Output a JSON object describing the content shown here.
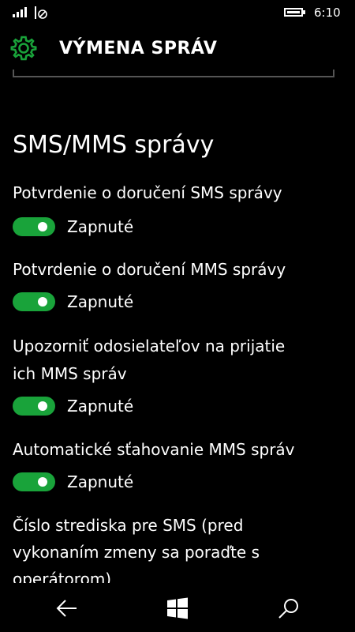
{
  "status_bar": {
    "time": "6:10"
  },
  "header": {
    "title": "VÝMENA SPRÁV",
    "icon": "gear-icon"
  },
  "section": {
    "title": "SMS/MMS správy"
  },
  "settings": [
    {
      "label": "Potvrdenie o doručení SMS správy",
      "state": "Zapnuté",
      "on": true
    },
    {
      "label": "Potvrdenie o doručení MMS správy",
      "state": "Zapnuté",
      "on": true
    },
    {
      "label_line1": "Upozorniť odosielateľov na prijatie",
      "label_line2": "ich MMS správ",
      "state": "Zapnuté",
      "on": true
    },
    {
      "label": "Automatické sťahovanie MMS správ",
      "state": "Zapnuté",
      "on": true
    }
  ],
  "sms_center": {
    "line1": "Číslo strediska pre SMS (pred",
    "line2": "vykonaním zmeny sa poraďte s",
    "line3": "operátorom)"
  },
  "colors": {
    "accent": "#19a33a",
    "background": "#000000",
    "text": "#ffffff"
  },
  "nav": {
    "back_icon": "back-arrow-icon",
    "start_icon": "windows-icon",
    "search_icon": "search-icon"
  }
}
